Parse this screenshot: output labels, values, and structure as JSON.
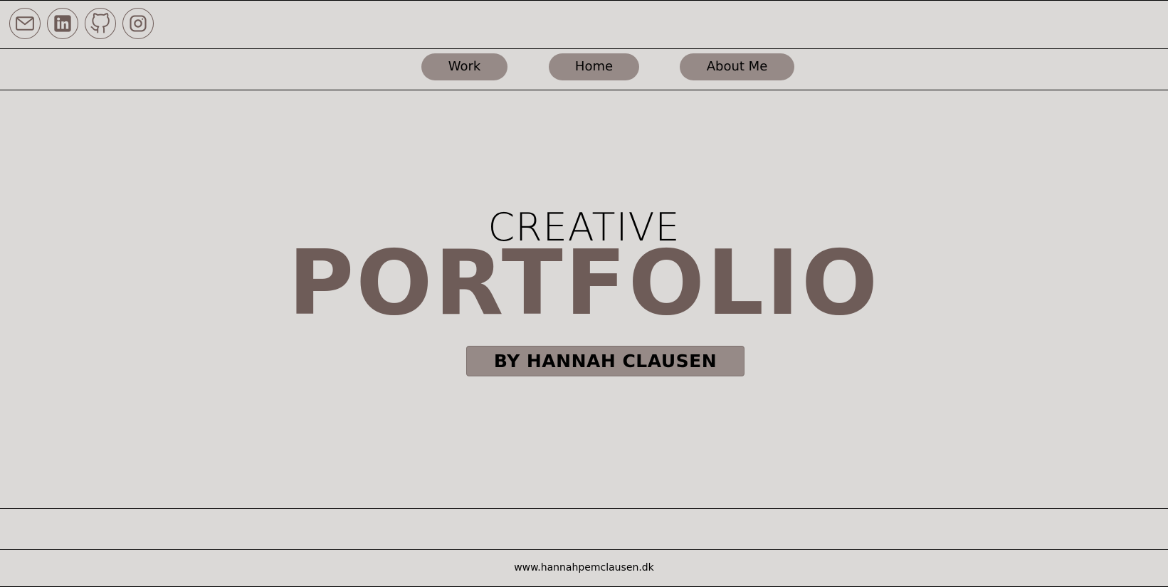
{
  "social": {
    "icons": [
      "mail-icon",
      "linkedin-icon",
      "github-icon",
      "instagram-icon"
    ]
  },
  "nav": {
    "work": "Work",
    "home": "Home",
    "about": "About Me"
  },
  "hero": {
    "kicker": "CREATIVE",
    "title": "PORTFOLIO",
    "byline": "BY HANNAH CLAUSEN"
  },
  "footer": {
    "url": "www.hannahpemclausen.dk"
  },
  "colors": {
    "background": "#dbd9d7",
    "accent": "#6e5c58",
    "button": "#968a87"
  }
}
